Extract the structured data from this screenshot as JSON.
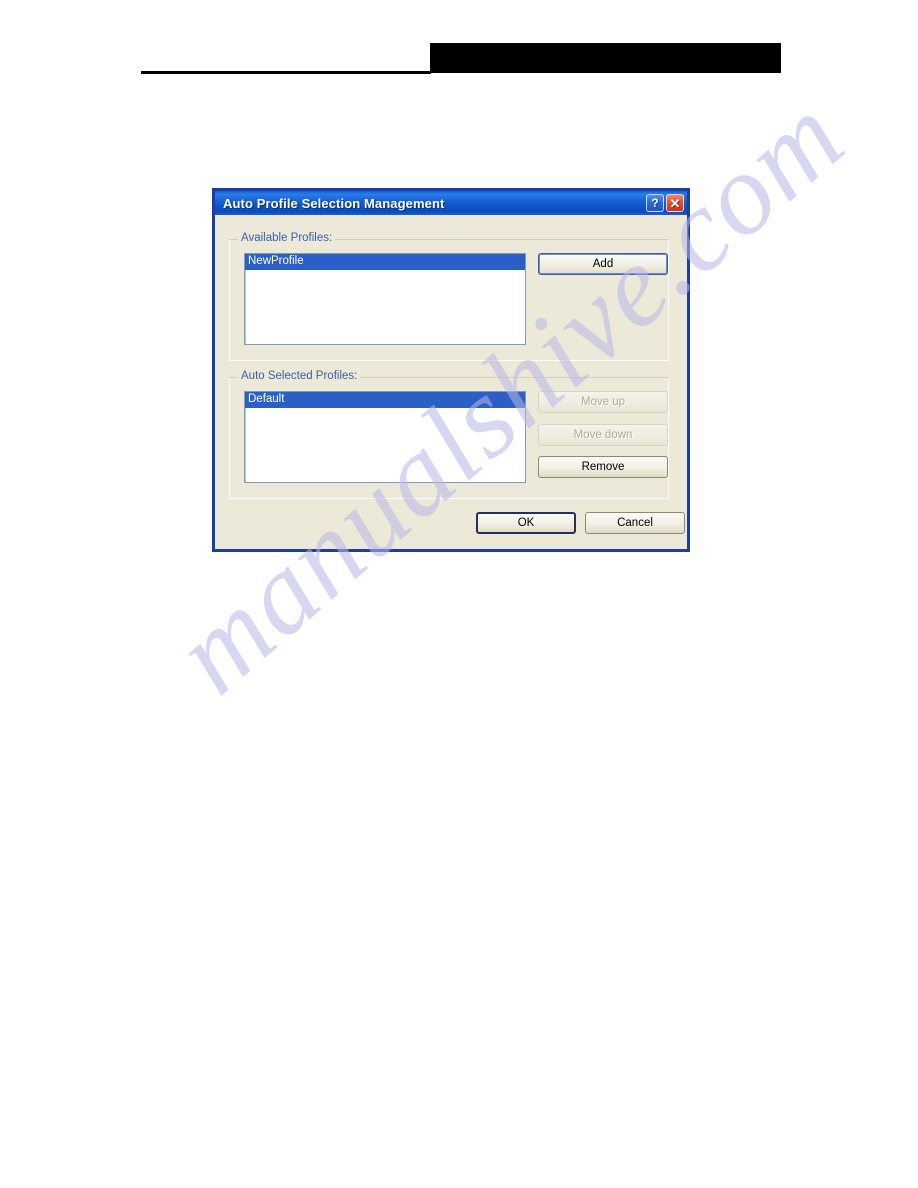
{
  "page": {
    "background_color": "#ffffff",
    "watermark_text": "manualshive.com",
    "watermark_color": "#b9b7e6"
  },
  "header": {
    "redaction_bar": "",
    "rule": ""
  },
  "dialog": {
    "title": "Auto Profile Selection Management",
    "frame_color": "#1b3f9e",
    "body_color": "#ece9d8",
    "titlebar_buttons": {
      "help": "?",
      "close": "✕"
    },
    "groups": [
      {
        "label": "Available Profiles:",
        "list": {
          "items": [
            {
              "text": "NewProfile",
              "selected": true
            }
          ]
        },
        "buttons": [
          {
            "label": "Add",
            "enabled": true,
            "focused": true
          }
        ]
      },
      {
        "label": "Auto Selected Profiles:",
        "list": {
          "items": [
            {
              "text": "Default",
              "selected": true
            }
          ]
        },
        "buttons": [
          {
            "label": "Move up",
            "enabled": false,
            "focused": false
          },
          {
            "label": "Move down",
            "enabled": false,
            "focused": false
          },
          {
            "label": "Remove",
            "enabled": true,
            "focused": false
          }
        ]
      }
    ],
    "footer_buttons": [
      {
        "label": "OK",
        "enabled": true,
        "default": true
      },
      {
        "label": "Cancel",
        "enabled": true,
        "default": false
      }
    ]
  },
  "selection_color": "#2a5fc8",
  "group_label_color": "#3a5fa8"
}
